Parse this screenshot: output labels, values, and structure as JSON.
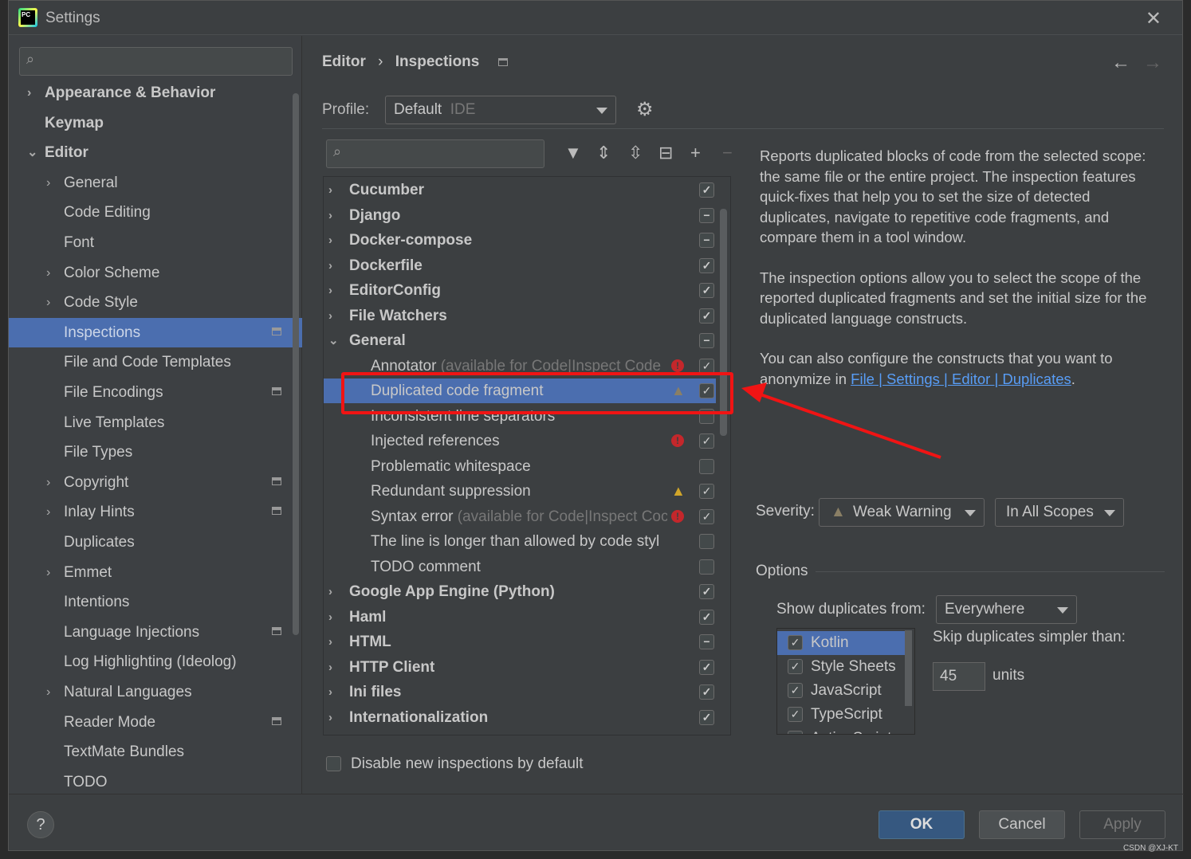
{
  "window": {
    "title": "Settings",
    "close": "✕"
  },
  "sidebar": {
    "items": [
      {
        "label": "Appearance & Behavior",
        "level": 0,
        "chevron": "›",
        "bold": true
      },
      {
        "label": "Keymap",
        "level": 0,
        "chevron": "",
        "bold": true
      },
      {
        "label": "Editor",
        "level": 0,
        "chevron": "⌄",
        "bold": true
      },
      {
        "label": "General",
        "level": 1,
        "chevron": "›"
      },
      {
        "label": "Code Editing",
        "level": 1,
        "chevron": ""
      },
      {
        "label": "Font",
        "level": 1,
        "chevron": ""
      },
      {
        "label": "Color Scheme",
        "level": 1,
        "chevron": "›"
      },
      {
        "label": "Code Style",
        "level": 1,
        "chevron": "›"
      },
      {
        "label": "Inspections",
        "level": 1,
        "chevron": "",
        "selected": true,
        "pin": true
      },
      {
        "label": "File and Code Templates",
        "level": 1,
        "chevron": ""
      },
      {
        "label": "File Encodings",
        "level": 1,
        "chevron": "",
        "pin": true
      },
      {
        "label": "Live Templates",
        "level": 1,
        "chevron": ""
      },
      {
        "label": "File Types",
        "level": 1,
        "chevron": ""
      },
      {
        "label": "Copyright",
        "level": 1,
        "chevron": "›",
        "pin": true
      },
      {
        "label": "Inlay Hints",
        "level": 1,
        "chevron": "›",
        "pin": true
      },
      {
        "label": "Duplicates",
        "level": 1,
        "chevron": ""
      },
      {
        "label": "Emmet",
        "level": 1,
        "chevron": "›"
      },
      {
        "label": "Intentions",
        "level": 1,
        "chevron": ""
      },
      {
        "label": "Language Injections",
        "level": 1,
        "chevron": "",
        "pin": true
      },
      {
        "label": "Log Highlighting (Ideolog)",
        "level": 1,
        "chevron": ""
      },
      {
        "label": "Natural Languages",
        "level": 1,
        "chevron": "›"
      },
      {
        "label": "Reader Mode",
        "level": 1,
        "chevron": "",
        "pin": true
      },
      {
        "label": "TextMate Bundles",
        "level": 1,
        "chevron": ""
      },
      {
        "label": "TODO",
        "level": 1,
        "chevron": ""
      }
    ]
  },
  "breadcrumb": {
    "parent": "Editor",
    "sep": "›",
    "current": "Inspections"
  },
  "profile": {
    "label": "Profile:",
    "value": "Default",
    "suffix": "IDE"
  },
  "tree": {
    "rows": [
      {
        "label": "Cucumber",
        "group": true,
        "chevron": "›",
        "state": "checked"
      },
      {
        "label": "Django",
        "group": true,
        "chevron": "›",
        "state": "mixed"
      },
      {
        "label": "Docker-compose",
        "group": true,
        "chevron": "›",
        "state": "mixed"
      },
      {
        "label": "Dockerfile",
        "group": true,
        "chevron": "›",
        "state": "checked"
      },
      {
        "label": "EditorConfig",
        "group": true,
        "chevron": "›",
        "state": "checked"
      },
      {
        "label": "File Watchers",
        "group": true,
        "chevron": "›",
        "state": "checked"
      },
      {
        "label": "General",
        "group": true,
        "chevron": "⌄",
        "state": "mixed"
      },
      {
        "label": "Annotator",
        "note": "(available for Code|Inspect Code",
        "severity": "error",
        "state": "checked"
      },
      {
        "label": "Duplicated code fragment",
        "severity": "weak",
        "state": "checked",
        "selected": true
      },
      {
        "label": "Inconsistent line separators",
        "state": "unchecked"
      },
      {
        "label": "Injected references",
        "severity": "error",
        "state": "checked"
      },
      {
        "label": "Problematic whitespace",
        "state": "unchecked"
      },
      {
        "label": "Redundant suppression",
        "severity": "warning",
        "state": "checked"
      },
      {
        "label": "Syntax error",
        "note": "(available for Code|Inspect Coc",
        "severity": "error",
        "state": "checked"
      },
      {
        "label": "The line is longer than allowed by code styl",
        "state": "unchecked"
      },
      {
        "label": "TODO comment",
        "state": "unchecked"
      },
      {
        "label": "Google App Engine (Python)",
        "group": true,
        "chevron": "›",
        "state": "checked"
      },
      {
        "label": "Haml",
        "group": true,
        "chevron": "›",
        "state": "checked"
      },
      {
        "label": "HTML",
        "group": true,
        "chevron": "›",
        "state": "mixed"
      },
      {
        "label": "HTTP Client",
        "group": true,
        "chevron": "›",
        "state": "checked"
      },
      {
        "label": "Ini files",
        "group": true,
        "chevron": "›",
        "state": "checked"
      },
      {
        "label": "Internationalization",
        "group": true,
        "chevron": "›",
        "state": "checked"
      }
    ]
  },
  "disable_new": {
    "label": "Disable new inspections by default",
    "checked": false
  },
  "description": {
    "p1": "Reports duplicated blocks of code from the selected scope: the same file or the entire project. The inspection features quick-fixes that help you to set the size of detected duplicates, navigate to repetitive code fragments, and compare them in a tool window.",
    "p2": "The inspection options allow you to select the scope of the reported duplicated fragments and set the initial size for the duplicated language constructs.",
    "p3_pre": "You can also configure the constructs that you want to anonymize in ",
    "p3_link": "File | Settings | Editor | Duplicates",
    "p3_post": "."
  },
  "severity": {
    "label": "Severity:",
    "value": "Weak Warning",
    "scope": "In All Scopes"
  },
  "options": {
    "title": "Options",
    "show_from_label": "Show duplicates from:",
    "show_from_value": "Everywhere",
    "languages": [
      {
        "label": "Kotlin",
        "checked": true,
        "selected": true
      },
      {
        "label": "Style Sheets",
        "checked": true
      },
      {
        "label": "JavaScript",
        "checked": true
      },
      {
        "label": "TypeScript",
        "checked": true
      },
      {
        "label": "ActionScript",
        "checked": true
      }
    ],
    "skip_label": "Skip duplicates simpler than:",
    "skip_value": "45",
    "units": "units"
  },
  "buttons": {
    "ok": "OK",
    "cancel": "Cancel",
    "apply": "Apply",
    "help": "?"
  },
  "watermark": "CSDN @XJ-KT",
  "colors": {
    "selection": "#4b6eaf",
    "annotation": "#f01414",
    "link": "#589df6"
  }
}
